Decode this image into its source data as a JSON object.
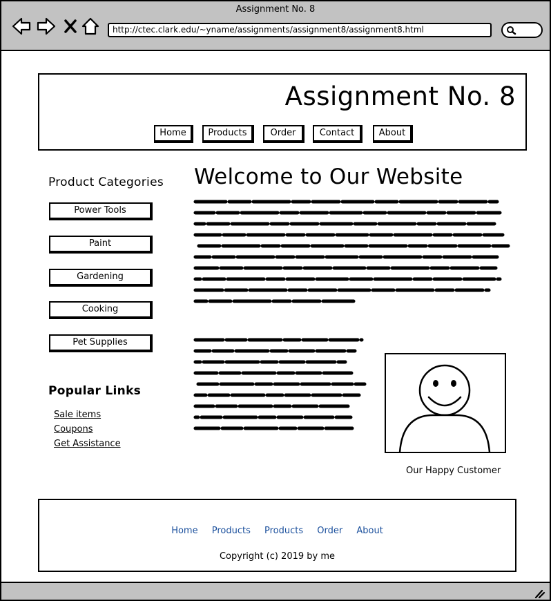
{
  "window": {
    "title": "Assignment No. 8"
  },
  "browser": {
    "url": "http://ctec.clark.edu/~yname/assignments/assignment8/assignment8.html",
    "buttons": {
      "back": "back-icon",
      "forward": "forward-icon",
      "stop": "close-icon",
      "home": "home-icon"
    }
  },
  "header": {
    "title": "Assignment No. 8",
    "nav": [
      "Home",
      "Products",
      "Order",
      "Contact",
      "About"
    ]
  },
  "sidebar": {
    "categories_heading": "Product Categories",
    "categories": [
      "Power Tools",
      "Paint",
      "Gardening",
      "Cooking",
      "Pet Supplies"
    ],
    "links_heading": "Popular Links",
    "links": [
      "Sale items",
      "Coupons",
      "Get Assistance"
    ]
  },
  "main": {
    "heading": "Welcome to Our Website",
    "image_caption": "Our Happy Customer"
  },
  "footer": {
    "nav": [
      "Home",
      "Products",
      "Products",
      "Order",
      "About"
    ],
    "copyright": "Copyright (c) 2019 by me"
  },
  "colors": {
    "chrome": "#c2c2c2",
    "footer_link": "#1a4f9c"
  }
}
